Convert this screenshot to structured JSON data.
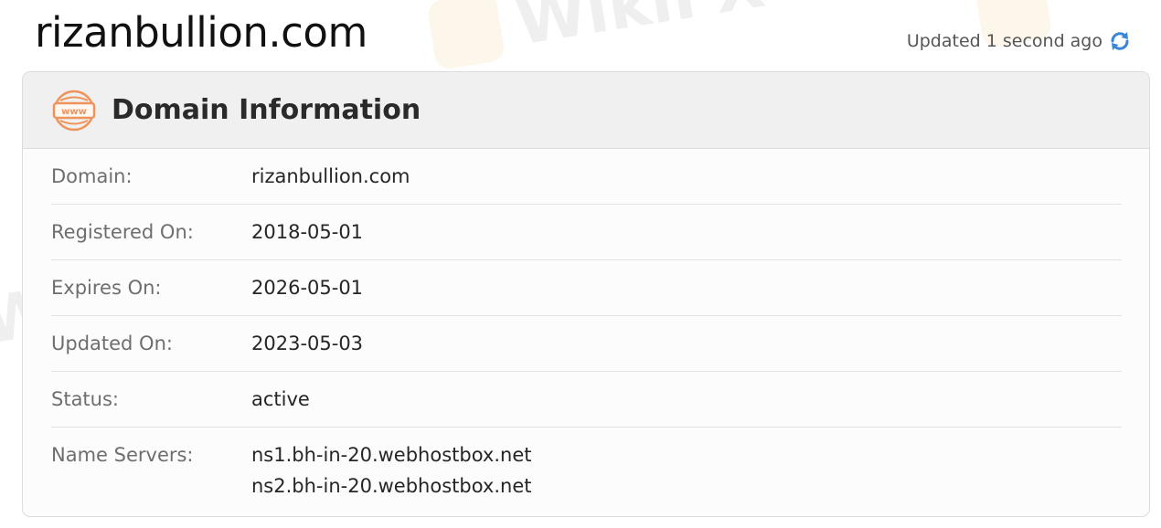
{
  "header": {
    "site_title": "rizanbullion.com",
    "updated_text": "Updated 1 second ago",
    "refresh_icon": "refresh-icon"
  },
  "card": {
    "title": "Domain Information",
    "icon": "www-globe-icon",
    "rows": [
      {
        "label": "Domain:",
        "value": "rizanbullion.com"
      },
      {
        "label": "Registered On:",
        "value": "2018-05-01"
      },
      {
        "label": "Expires On:",
        "value": "2026-05-01"
      },
      {
        "label": "Updated On:",
        "value": "2023-05-03"
      },
      {
        "label": "Status:",
        "value": "active"
      },
      {
        "label": "Name Servers:",
        "values": [
          "ns1.bh-in-20.webhostbox.net",
          "ns2.bh-in-20.webhostbox.net"
        ]
      }
    ]
  },
  "watermark": {
    "text": "WikiFX"
  },
  "colors": {
    "accent_orange": "#f0935a",
    "refresh_blue": "#3b86d8",
    "header_bg": "#f0f0f0",
    "label_gray": "#6e6e6e"
  }
}
